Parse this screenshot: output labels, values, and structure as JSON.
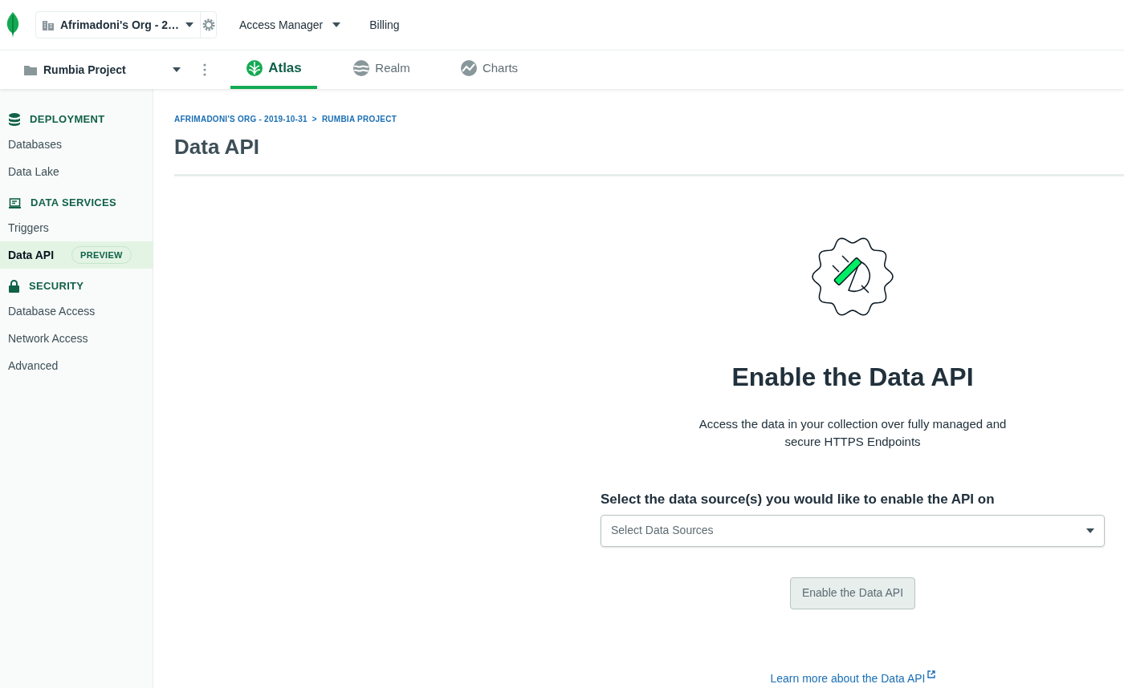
{
  "top_bar": {
    "org": "Afrimadoni's Org - 2…",
    "links": [
      {
        "label": "Access Manager",
        "dropdown": true
      },
      {
        "label": "Billing",
        "dropdown": false
      }
    ]
  },
  "project_bar": {
    "project": "Rumbia Project",
    "tabs": [
      {
        "label": "Atlas",
        "selected": true
      },
      {
        "label": "Realm",
        "selected": false
      },
      {
        "label": "Charts",
        "selected": false
      }
    ]
  },
  "sidebar": {
    "sections": [
      {
        "title": "DEPLOYMENT",
        "items": [
          {
            "label": "Databases",
            "selected": false
          },
          {
            "label": "Data Lake",
            "selected": false
          }
        ]
      },
      {
        "title": "DATA SERVICES",
        "items": [
          {
            "label": "Triggers",
            "selected": false
          },
          {
            "label": "Data API",
            "selected": true,
            "badge": "PREVIEW"
          }
        ]
      },
      {
        "title": "SECURITY",
        "items": [
          {
            "label": "Database Access",
            "selected": false
          },
          {
            "label": "Network Access",
            "selected": false
          },
          {
            "label": "Advanced",
            "selected": false
          }
        ]
      }
    ]
  },
  "breadcrumb": [
    "AFRIMADONI'S ORG - 2019-10-31",
    ">",
    "RUMBIA PROJECT"
  ],
  "page_title": "Data API",
  "empty_state": {
    "heading": "Enable the Data API",
    "description": "Access the data in your collection over fully managed and secure HTTPS Endpoints",
    "select_label": "Select the data source(s) you would like to enable the API on",
    "select": {
      "placeholder": "Select Data Sources"
    },
    "button": {
      "label": "Enable the Data API",
      "disabled": true
    },
    "link": "Learn more about the Data API"
  }
}
